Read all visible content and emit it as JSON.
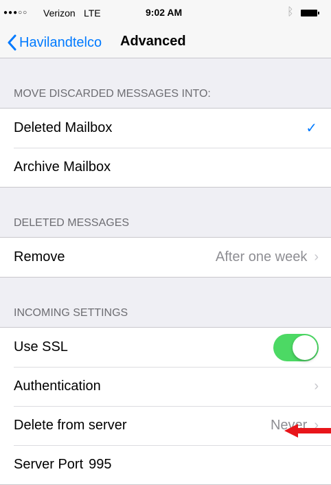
{
  "status_bar": {
    "signal": "●●●○○",
    "carrier": "Verizon",
    "network": "LTE",
    "time": "9:02 AM",
    "bluetooth_icon": "bluetooth-icon",
    "battery_icon": "battery-icon"
  },
  "nav": {
    "back_label": "Havilandtelco",
    "title": "Advanced"
  },
  "sections": [
    {
      "header": "MOVE DISCARDED MESSAGES INTO:",
      "rows": [
        {
          "label": "Deleted Mailbox",
          "checked": true
        },
        {
          "label": "Archive Mailbox",
          "checked": false
        }
      ]
    },
    {
      "header": "DELETED MESSAGES",
      "rows": [
        {
          "label": "Remove",
          "value": "After one week"
        }
      ]
    },
    {
      "header": "INCOMING SETTINGS",
      "rows": [
        {
          "label": "Use SSL",
          "toggle": true
        },
        {
          "label": "Authentication"
        },
        {
          "label": "Delete from server",
          "value": "Never"
        },
        {
          "label": "Server Port",
          "value": "995"
        }
      ]
    }
  ],
  "colors": {
    "accent": "#007aff",
    "toggle_on": "#4cd964",
    "annotation_arrow": "#e8151a"
  }
}
